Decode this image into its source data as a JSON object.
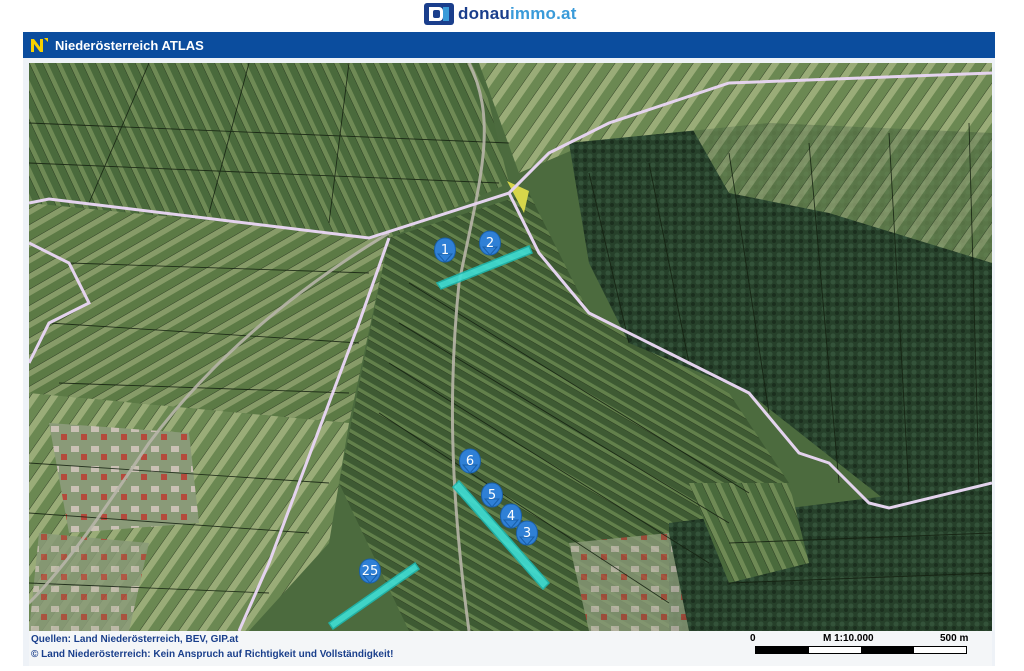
{
  "brand": {
    "name_main": "donau",
    "name_rest": "immo.at",
    "logo_letter": "D"
  },
  "atlas": {
    "title": "Niederösterreich ATLAS",
    "logo_letter": "N"
  },
  "map": {
    "pins": [
      {
        "label": "1"
      },
      {
        "label": "2"
      },
      {
        "label": "6"
      },
      {
        "label": "5"
      },
      {
        "label": "4"
      },
      {
        "label": "3"
      },
      {
        "label": "25"
      }
    ],
    "colors": {
      "pin": "#2f80d6",
      "parcel_highlight": "#3fe0d6",
      "boundary": "#e4d3ee",
      "field_dark": "#3a5431",
      "field_light": "#8aa06a",
      "forest": "#24391f"
    }
  },
  "footer": {
    "sources": "Quellen: Land Niederösterreich, BEV, GIP.at",
    "disclaimer": "© Land Niederösterreich: Kein Anspruch auf Richtigkeit und Vollständigkeit!",
    "scale_zero": "0",
    "scale_ratio": "M 1:10.000",
    "scale_end": "500 m"
  }
}
